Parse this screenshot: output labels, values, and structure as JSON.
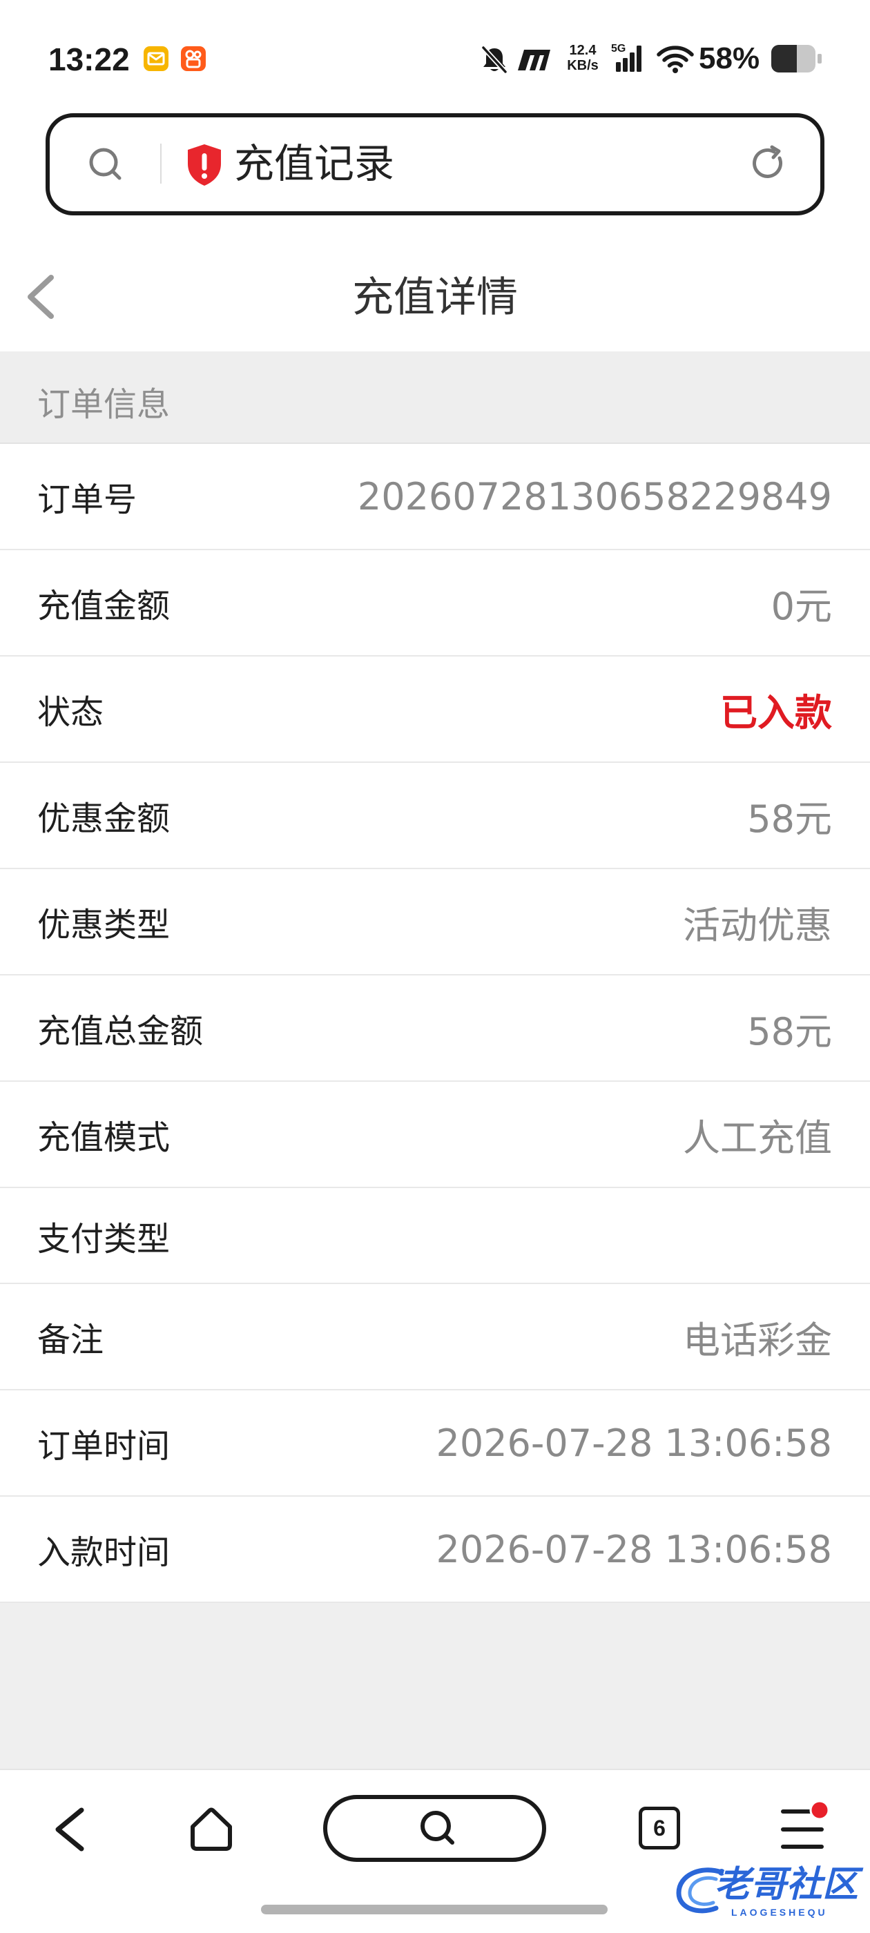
{
  "status_bar": {
    "time": "13:22",
    "notification_icons": [
      "mail-app-icon",
      "kuaishou-app-icon"
    ],
    "system_icons": [
      "mute-bell-icon",
      "hyper-m-icon",
      "signal-icon",
      "wifi-icon",
      "battery-icon"
    ],
    "net_speed_value": "12.4",
    "net_speed_unit": "KB/s",
    "network_type": "5G",
    "battery_text": "58%",
    "battery_level": 58
  },
  "address_bar": {
    "title": "充值记录",
    "icons": [
      "search-icon",
      "security-shield-icon",
      "refresh-icon"
    ]
  },
  "header": {
    "title": "充值详情",
    "back_icon": "chevron-left-icon"
  },
  "section": {
    "title": "订单信息"
  },
  "details": [
    {
      "label": "订单号",
      "value": "20260728130658229849"
    },
    {
      "label": "充值金额",
      "value": "0元"
    },
    {
      "label": "状态",
      "value": "已入款"
    },
    {
      "label": "优惠金额",
      "value": "58元"
    },
    {
      "label": "优惠类型",
      "value": "活动优惠"
    },
    {
      "label": "充值总金额",
      "value": "58元"
    },
    {
      "label": "充值模式",
      "value": "人工充值"
    },
    {
      "label": "支付类型",
      "value": ""
    },
    {
      "label": "备注",
      "value": "电话彩金"
    },
    {
      "label": "订单时间",
      "value": "2026-07-28 13:06:58"
    },
    {
      "label": "入款时间",
      "value": "2026-07-28 13:06:58"
    }
  ],
  "colors": {
    "status_value": "#e01b22",
    "shield": "#e8262d",
    "notification_dot": "#e8202a",
    "watermark": "#2a66d8"
  },
  "bottom_nav": {
    "tab_count": "6",
    "icons": [
      "back-arrow-icon",
      "home-icon",
      "search-icon",
      "tabs-icon",
      "menu-icon"
    ]
  },
  "watermark": {
    "text": "老哥社区",
    "subtext": "LAOGESHEQU"
  }
}
